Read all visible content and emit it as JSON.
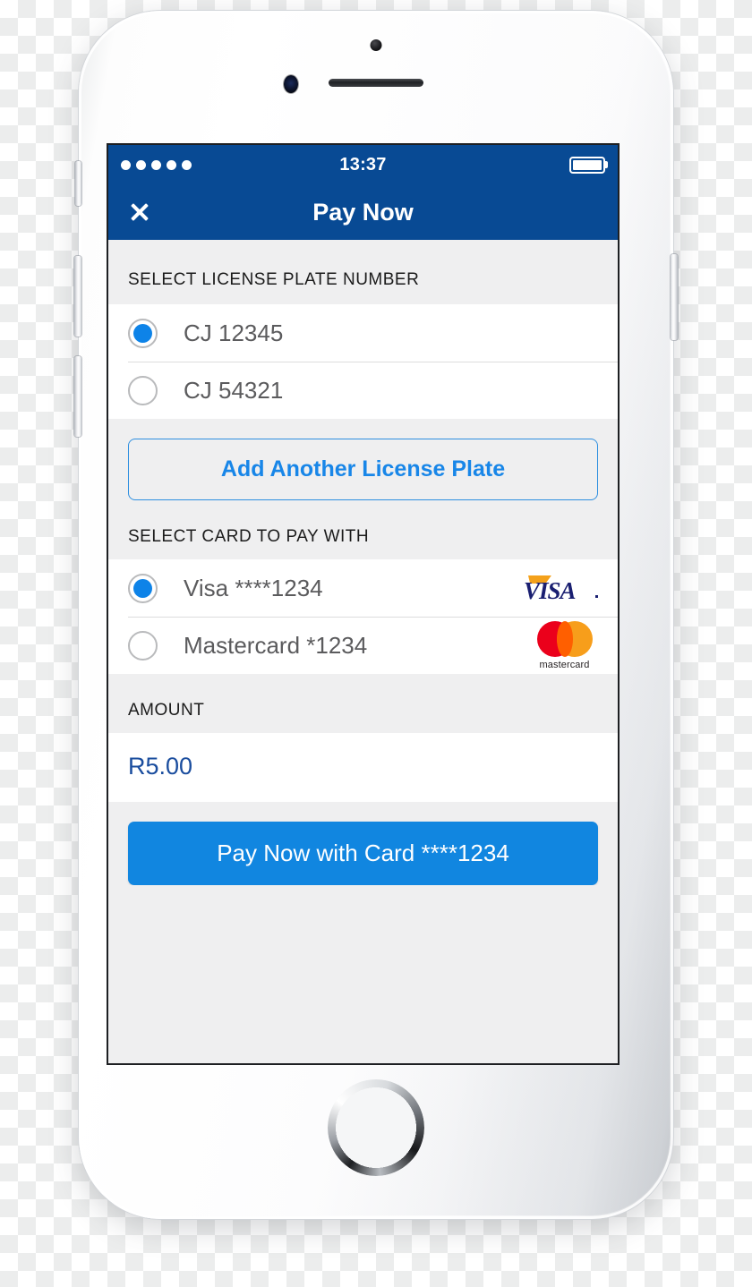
{
  "status_bar": {
    "signal_dots": 5,
    "time": "13:37",
    "battery_icon": "battery-full-icon"
  },
  "nav_bar": {
    "close_icon": "close-icon",
    "title": "Pay Now"
  },
  "license_plate_section": {
    "header": "SELECT LICENSE PLATE NUMBER",
    "options": [
      {
        "label": "CJ 12345",
        "selected": true
      },
      {
        "label": "CJ 54321",
        "selected": false
      }
    ],
    "add_button_label": "Add Another License Plate"
  },
  "card_section": {
    "header": "SELECT CARD TO PAY WITH",
    "options": [
      {
        "label": "Visa ****1234",
        "selected": true,
        "logo": "visa-logo",
        "logo_text": "VISA"
      },
      {
        "label": "Mastercard *1234",
        "selected": false,
        "logo": "mastercard-logo",
        "logo_text": "mastercard"
      }
    ]
  },
  "amount_section": {
    "header": "AMOUNT",
    "value": "R5.00"
  },
  "pay_button": {
    "label": "Pay Now with Card ****1234"
  },
  "colors": {
    "header_blue": "#084a94",
    "accent_blue": "#1186e0",
    "link_blue": "#1886e8",
    "amount_navy": "#1a4d9e",
    "screen_bg": "#efeff0",
    "row_bg": "#ffffff",
    "visa_navy": "#1a1f71",
    "visa_gold": "#f4a11b",
    "mastercard_red": "#eb001b",
    "mastercard_yellow": "#f79e1b",
    "mastercard_overlap": "#ff5f00"
  }
}
